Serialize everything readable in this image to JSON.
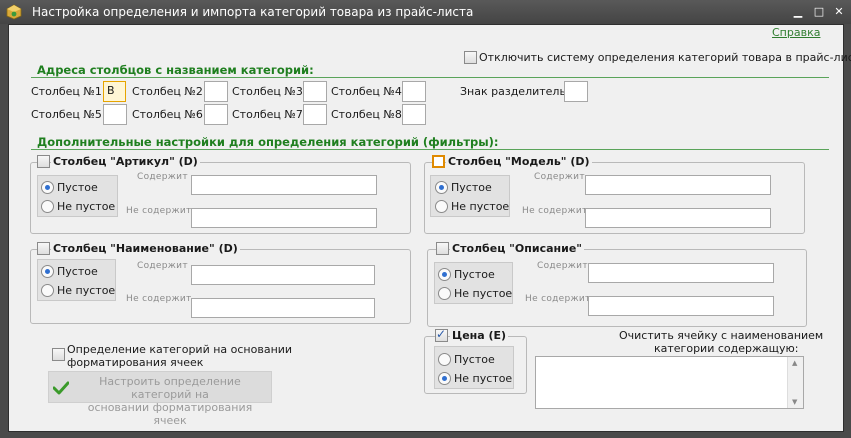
{
  "window": {
    "title": "Настройка определения и импорта категорий товара из прайс-листа",
    "minimize": "▁",
    "maximize": "□",
    "close": "✕"
  },
  "help_link": "Справка",
  "disable_system_label": "Отключить систему определения категорий товара в прайс-листе",
  "address_section": {
    "title": "Адреса столбцов с названием категорий:",
    "columns": [
      {
        "label": "Столбец №1:",
        "value": "B"
      },
      {
        "label": "Столбец №2:",
        "value": ""
      },
      {
        "label": "Столбец №3:",
        "value": ""
      },
      {
        "label": "Столбец №4:",
        "value": ""
      },
      {
        "label": "Столбец №5:",
        "value": ""
      },
      {
        "label": "Столбец №6:",
        "value": ""
      },
      {
        "label": "Столбец №7:",
        "value": ""
      },
      {
        "label": "Столбец №8:",
        "value": ""
      }
    ],
    "separator_label": "Знак разделитель:",
    "separator_value": ""
  },
  "filters_section": {
    "title": "Дополнительные настройки для определения категорий (фильтры):"
  },
  "groups": {
    "article": {
      "title": "Столбец \"Артикул\" (D)",
      "radio_empty": "Пустое",
      "radio_not_empty": "Не пустое",
      "contains_label": "Содержит",
      "not_contains_label": "Не содержит"
    },
    "model": {
      "title": "Столбец \"Модель\" (D)",
      "radio_empty": "Пустое",
      "radio_not_empty": "Не пустое",
      "contains_label": "Содержит",
      "not_contains_label": "Не содержит"
    },
    "name": {
      "title": "Столбец \"Наименование\" (D)",
      "radio_empty": "Пустое",
      "radio_not_empty": "Не пустое",
      "contains_label": "Содержит",
      "not_contains_label": "Не содержит"
    },
    "description": {
      "title": "Столбец \"Описание\"",
      "radio_empty": "Пустое",
      "radio_not_empty": "Не пустое",
      "contains_label": "Содержит",
      "not_contains_label": "Не содержит"
    },
    "price": {
      "title": "Цена (E)",
      "radio_empty": "Пустое",
      "radio_not_empty": "Не пустое"
    }
  },
  "formatting": {
    "checkbox_label_line1": "Определение категорий на основании",
    "checkbox_label_line2": "форматирования ячеек",
    "button_line1": "Настроить определение категорий на",
    "button_line2": "основании форматирования ячеек"
  },
  "clear_cell": {
    "label_line1": "Очистить ячейку с наименованием",
    "label_line2": "категории содержащую:",
    "value": ""
  },
  "colors": {
    "accent_green": "#1f7f1f",
    "focus_orange": "#e6a400",
    "radio_blue": "#2f6fd0"
  }
}
